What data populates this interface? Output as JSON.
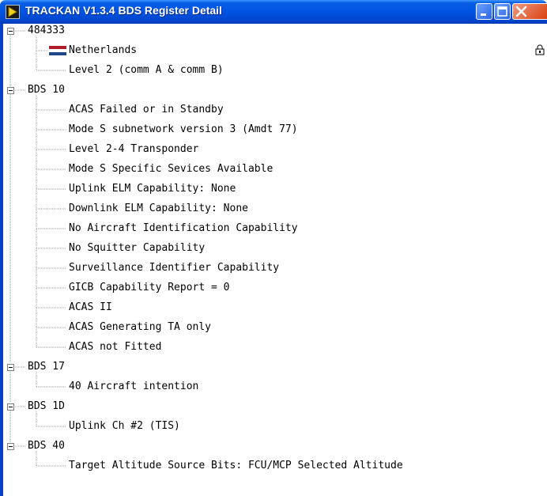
{
  "window": {
    "title": "TRACKAN V1.3.4 BDS Register Detail"
  },
  "tree": {
    "groups": [
      {
        "label": "484333",
        "items": [
          {
            "label": "Netherlands",
            "icon": "netherlands-flag-icon"
          },
          {
            "label": "Level 2 (comm A & comm B)"
          }
        ]
      },
      {
        "label": "BDS 10",
        "items": [
          {
            "label": "ACAS Failed or in Standby"
          },
          {
            "label": "Mode S subnetwork version 3 (Amdt 77)"
          },
          {
            "label": "Level 2-4 Transponder"
          },
          {
            "label": "Mode S Specific Sevices Available"
          },
          {
            "label": "Uplink ELM Capability: None"
          },
          {
            "label": "Downlink ELM Capability: None"
          },
          {
            "label": "No Aircraft Identification Capability"
          },
          {
            "label": "No Squitter Capability"
          },
          {
            "label": "Surveillance Identifier Capability"
          },
          {
            "label": "GICB Capability Report = 0"
          },
          {
            "label": "ACAS II"
          },
          {
            "label": "ACAS Generating TA only"
          },
          {
            "label": "ACAS not Fitted"
          }
        ]
      },
      {
        "label": "BDS 17",
        "items": [
          {
            "label": "40 Aircraft intention"
          }
        ]
      },
      {
        "label": "BDS 1D",
        "items": [
          {
            "label": "Uplink Ch #2 (TIS)"
          }
        ]
      },
      {
        "label": "BDS 40",
        "items": [
          {
            "label": "Target Altitude Source Bits: FCU/MCP Selected Altitude"
          }
        ]
      }
    ]
  },
  "colors": {
    "titlebar": "#0055e5",
    "flag_red": "#ae1c28",
    "flag_white": "#ffffff",
    "flag_blue": "#21468b"
  }
}
